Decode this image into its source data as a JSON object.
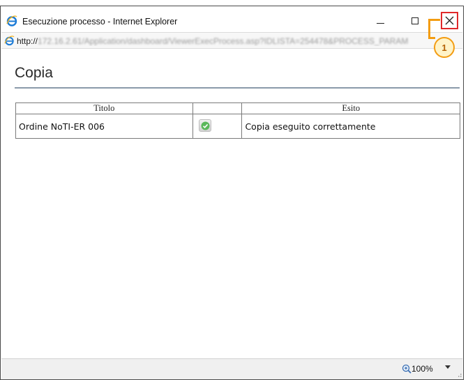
{
  "window": {
    "title": "Esecuzione processo - Internet Explorer",
    "address": "http://",
    "address_blurred": "172.16.2.61/Application/dashboard/ViewerExecProcess.asp?IDLISTA=254478&PROCESS_PARAM"
  },
  "callout": {
    "number": "1"
  },
  "page": {
    "title": "Copia",
    "table": {
      "headers": [
        "Titolo",
        "",
        "Esito"
      ],
      "rows": [
        {
          "titolo": "Ordine NoTI-ER 006",
          "status_icon": "success-check-icon",
          "esito": "Copia eseguito correttamente"
        }
      ]
    }
  },
  "statusbar": {
    "zoom": "100%"
  },
  "colors": {
    "accent_red": "#e0282a",
    "callout_orange": "#f39c12",
    "success_green": "#4caf50"
  }
}
